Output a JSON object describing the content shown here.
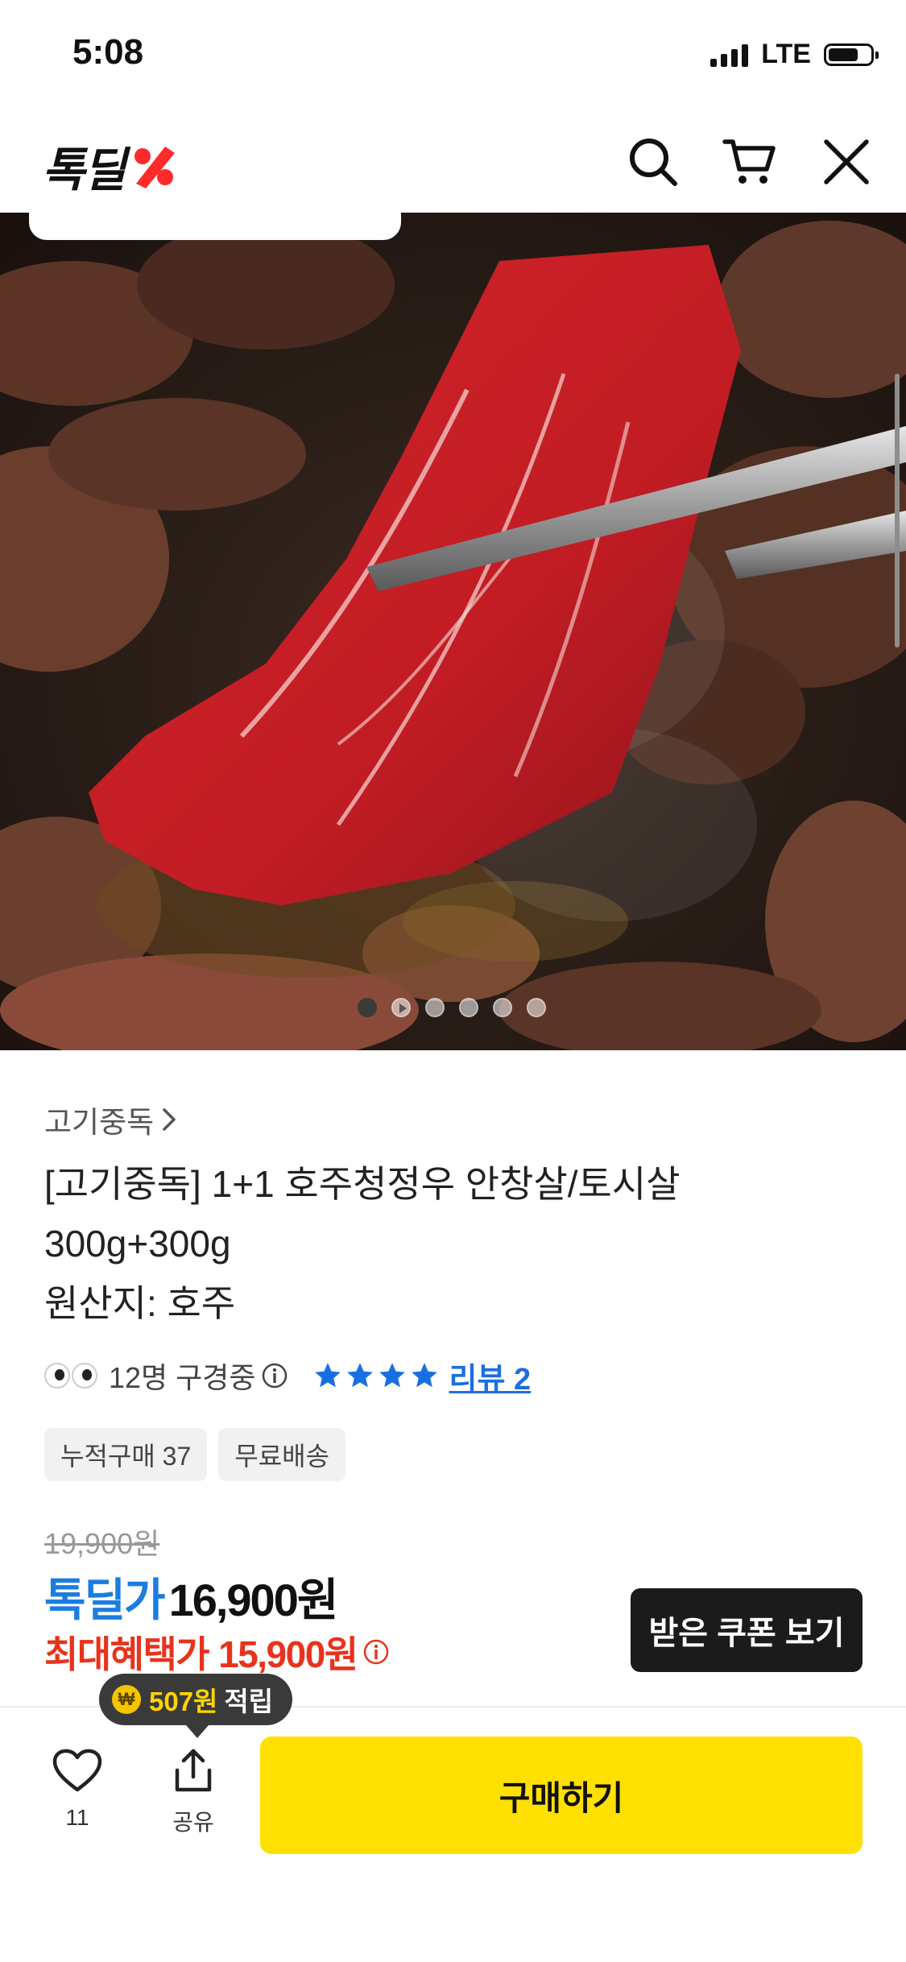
{
  "status_bar": {
    "time": "5:08",
    "network": "LTE"
  },
  "header": {
    "logo_text": "톡딜",
    "icons": [
      "search-icon",
      "cart-icon",
      "close-icon"
    ]
  },
  "hero": {
    "image_alt": "",
    "carousel_dots": 6,
    "active_dot": 1
  },
  "product": {
    "brand": "고기중독",
    "title_lines": [
      "[고기중독] 1+1 호주청정우 안창살/토시살",
      "300g+300g",
      "원산지: 호주"
    ],
    "viewers": "12명 구경중",
    "rating_stars": 4,
    "review_link": "리뷰 2",
    "tags": [
      "누적구매 37",
      "무료배송"
    ],
    "original_price": "19,900원",
    "deal_label": "톡딜가",
    "deal_price": "16,900원",
    "benefit_label": "최대혜택가",
    "benefit_price": "15,900원",
    "coupon_button": "받은 쿠폰 보기"
  },
  "points_tooltip": {
    "amount": "507원",
    "label": "적립"
  },
  "bottom_bar": {
    "like_count": "11",
    "share_label": "공유",
    "buy_button": "구매하기"
  },
  "colors": {
    "deal_blue": "#1a7de0",
    "benefit_red": "#e8331c",
    "buy_yellow": "#ffe000",
    "logo_red": "#ff2a2a"
  }
}
